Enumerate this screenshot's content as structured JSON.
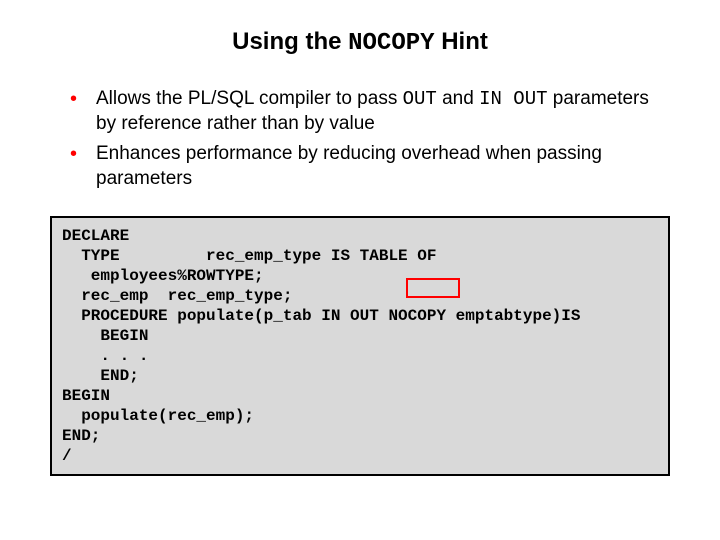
{
  "title": {
    "pre": "Using the ",
    "mono": "NOCOPY",
    "post": " Hint"
  },
  "bullets": [
    {
      "pre": "Allows the PL/SQL compiler to pass ",
      "mono1": "OUT",
      "mid": " and ",
      "mono2": "IN OUT",
      "post": " parameters by reference rather than by value"
    },
    {
      "pre": "Enhances performance by reducing overhead when passing parameters",
      "mono1": "",
      "mid": "",
      "mono2": "",
      "post": ""
    }
  ],
  "code": "DECLARE\n  TYPE         rec_emp_type IS TABLE OF\n   employees%ROWTYPE;\n  rec_emp  rec_emp_type;\n  PROCEDURE populate(p_tab IN OUT NOCOPY emptabtype)IS\n    BEGIN\n    . . .\n    END;\nBEGIN\n  populate(rec_emp);\nEND;\n/"
}
